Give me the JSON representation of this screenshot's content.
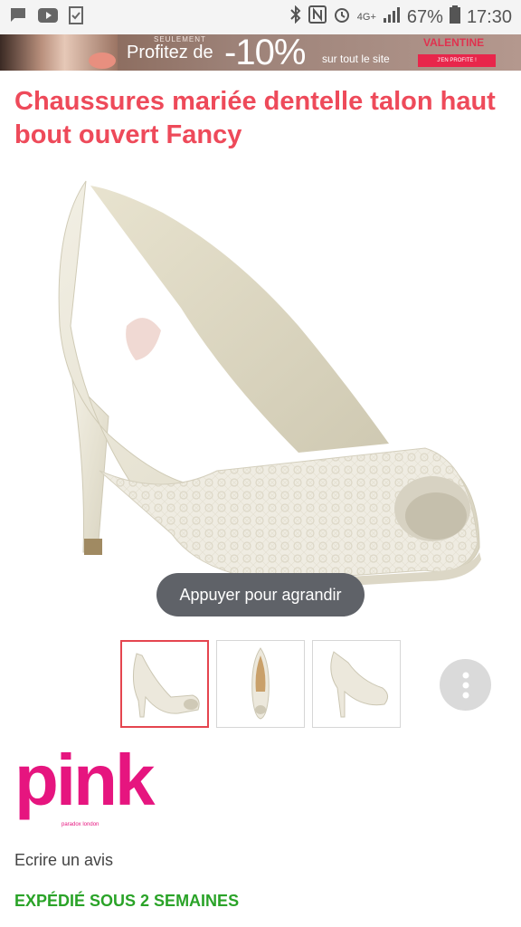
{
  "status_bar": {
    "network": "4G+",
    "battery": "67%",
    "time": "17:30",
    "icons": [
      "message-icon",
      "youtube-icon",
      "checklist-icon",
      "bluetooth-icon",
      "nfc-icon",
      "alarm-icon",
      "signal-icon",
      "battery-icon"
    ]
  },
  "banner": {
    "small_text": "SEULEMENT",
    "offer_prefix": "Profitez de",
    "offer_percent": "-10%",
    "offer_suffix": "sur tout le site",
    "campaign": "VALENTINE",
    "cta": "J'EN PROFITE !"
  },
  "product": {
    "title": "Chaussures mariée dentelle talon haut bout ouvert Fancy",
    "zoom_hint": "Appuyer pour agrandir"
  },
  "brand": {
    "name": "pink",
    "tagline": "paradox london"
  },
  "actions": {
    "review": "Ecrire un avis"
  },
  "shipping": {
    "text": "EXPÉDIÉ SOUS 2 SEMAINES",
    "color": "#2aa328"
  },
  "colors": {
    "title": "#ee4a5a",
    "brand": "#e6157f",
    "active_thumb_border": "#e5454f"
  }
}
